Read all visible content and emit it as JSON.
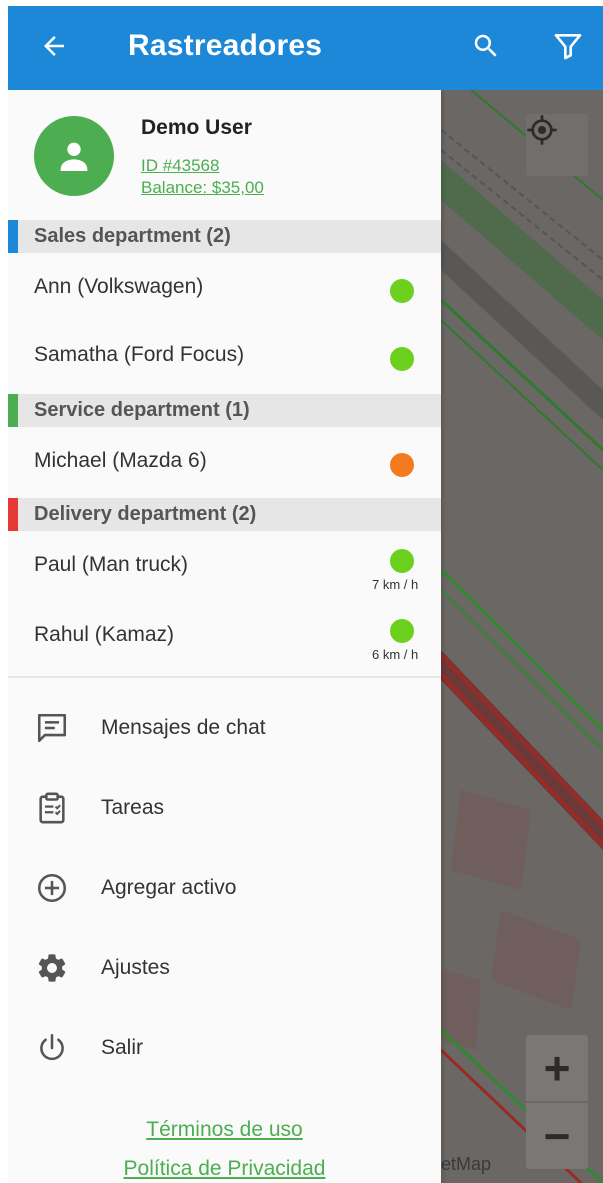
{
  "appbar": {
    "title": "Rastreadores",
    "color": "#1e88d8"
  },
  "user": {
    "name": "Demo User",
    "id": "ID #43568",
    "balance": "Balance: $35,00"
  },
  "groups": [
    {
      "label": "Sales department (2)",
      "stripe_color": "#1e88d8",
      "trackers": [
        {
          "name": "Ann (Volkswagen)",
          "status_color": "#6bd11e",
          "speed": ""
        },
        {
          "name": "Samatha (Ford Focus)",
          "status_color": "#6bd11e",
          "speed": ""
        }
      ]
    },
    {
      "label": "Service department (1)",
      "stripe_color": "#4cae50",
      "trackers": [
        {
          "name": "Michael (Mazda 6)",
          "status_color": "#f47a1f",
          "speed": ""
        }
      ]
    },
    {
      "label": "Delivery department (2)",
      "stripe_color": "#e53935",
      "trackers": [
        {
          "name": "Paul (Man truck)",
          "status_color": "#6bd11e",
          "speed": "7 km / h"
        },
        {
          "name": "Rahul (Kamaz)",
          "status_color": "#6bd11e",
          "speed": "6 km / h"
        }
      ]
    }
  ],
  "menu": [
    {
      "label": "Mensajes de chat",
      "icon": "chat-icon"
    },
    {
      "label": "Tareas",
      "icon": "tasks-icon"
    },
    {
      "label": "Agregar activo",
      "icon": "add-circle-icon"
    },
    {
      "label": "Ajustes",
      "icon": "gear-icon"
    },
    {
      "label": "Salir",
      "icon": "power-icon"
    }
  ],
  "footer": {
    "terms": "Términos de uso",
    "privacy": "Política de Privacidad"
  },
  "map": {
    "credit": "etMap",
    "zoom_in": "+",
    "zoom_out": "−"
  }
}
